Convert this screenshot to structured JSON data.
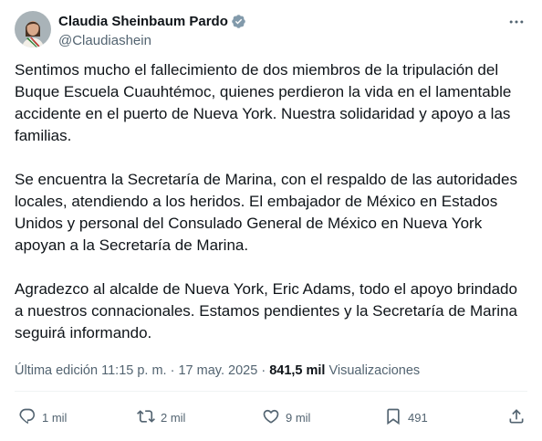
{
  "author": {
    "display_name": "Claudia Sheinbaum Pardo",
    "handle": "@Claudiashein",
    "verified": true
  },
  "tweet": {
    "paragraphs": [
      "Sentimos mucho el fallecimiento de dos miembros de la tripulación del Buque Escuela Cuauhtémoc, quienes perdieron la vida en el lamentable accidente en el puerto de Nueva York. Nuestra solidaridad y apoyo a las familias.",
      "Se encuentra la Secretaría de Marina, con el respaldo de las autoridades locales, atendiendo a los heridos. El embajador de México en Estados Unidos y personal del Consulado General de México en Nueva York apoyan a la Secretaría de Marina.",
      "Agradezco al alcalde de Nueva York, Eric Adams, todo el apoyo brindado a nuestros connacionales. Estamos pendientes y la Secretaría de Marina seguirá informando."
    ]
  },
  "meta": {
    "edited_label": "Última edición",
    "time": "11:15 p. m.",
    "separator": "·",
    "date": "17 may. 2025",
    "views_count": "841,5 mil",
    "views_label": "Visualizaciones"
  },
  "actions": {
    "replies": "1 mil",
    "reposts": "2 mil",
    "likes": "9 mil",
    "bookmarks": "491"
  },
  "colors": {
    "text": "#0f1419",
    "secondary": "#536471",
    "verified": "#829aab",
    "divider": "#eff3f4"
  },
  "icons": [
    "verified-badge-icon",
    "more-icon",
    "reply-icon",
    "repost-icon",
    "like-icon",
    "bookmark-icon",
    "share-icon"
  ]
}
